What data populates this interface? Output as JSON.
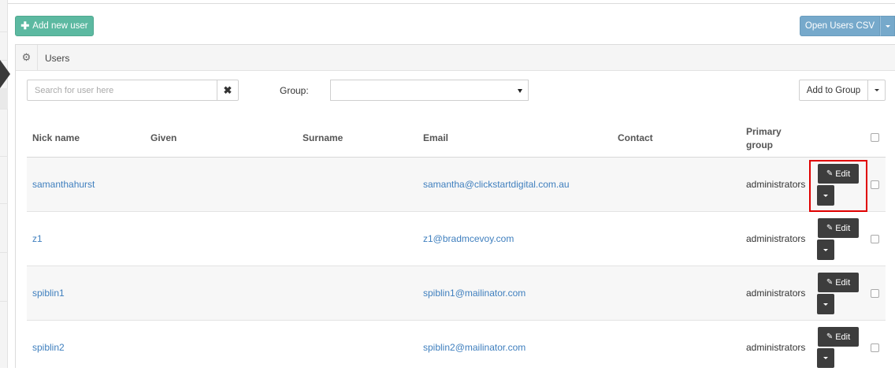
{
  "toolbar": {
    "add_user_label": "Add new user",
    "open_csv_label": "Open Users CSV"
  },
  "panel": {
    "title": "Users"
  },
  "filters": {
    "search_placeholder": "Search for user here",
    "clear_symbol": "✖",
    "group_label": "Group:",
    "group_value": "",
    "add_to_group_label": "Add to Group"
  },
  "table": {
    "headers": {
      "nick": "Nick name",
      "given": "Given",
      "surname": "Surname",
      "email": "Email",
      "contact": "Contact",
      "primary_group_line1": "Primary",
      "primary_group_line2": "group"
    },
    "edit_label": "Edit",
    "rows": [
      {
        "nick": "samanthahurst",
        "given": "",
        "surname": "",
        "email": "samantha@clickstartdigital.com.au",
        "contact": "",
        "primary_group": "administrators"
      },
      {
        "nick": "z1",
        "given": "",
        "surname": "",
        "email": "z1@bradmcevoy.com",
        "contact": "",
        "primary_group": "administrators"
      },
      {
        "nick": "spiblin1",
        "given": "",
        "surname": "",
        "email": "spiblin1@mailinator.com",
        "contact": "",
        "primary_group": "administrators"
      },
      {
        "nick": "spiblin2",
        "given": "",
        "surname": "",
        "email": "spiblin2@mailinator.com",
        "contact": "",
        "primary_group": "administrators"
      }
    ]
  },
  "colors": {
    "add_button": "#5cb9a1",
    "csv_button": "#76a9cb",
    "link": "#3f7fbe",
    "edit_button": "#3d3d3d",
    "highlight": "#e00000"
  },
  "icons": {
    "add": "plus-icon",
    "settings": "gear-icon",
    "edit": "edit-icon",
    "dropdown": "caret-down-icon"
  }
}
